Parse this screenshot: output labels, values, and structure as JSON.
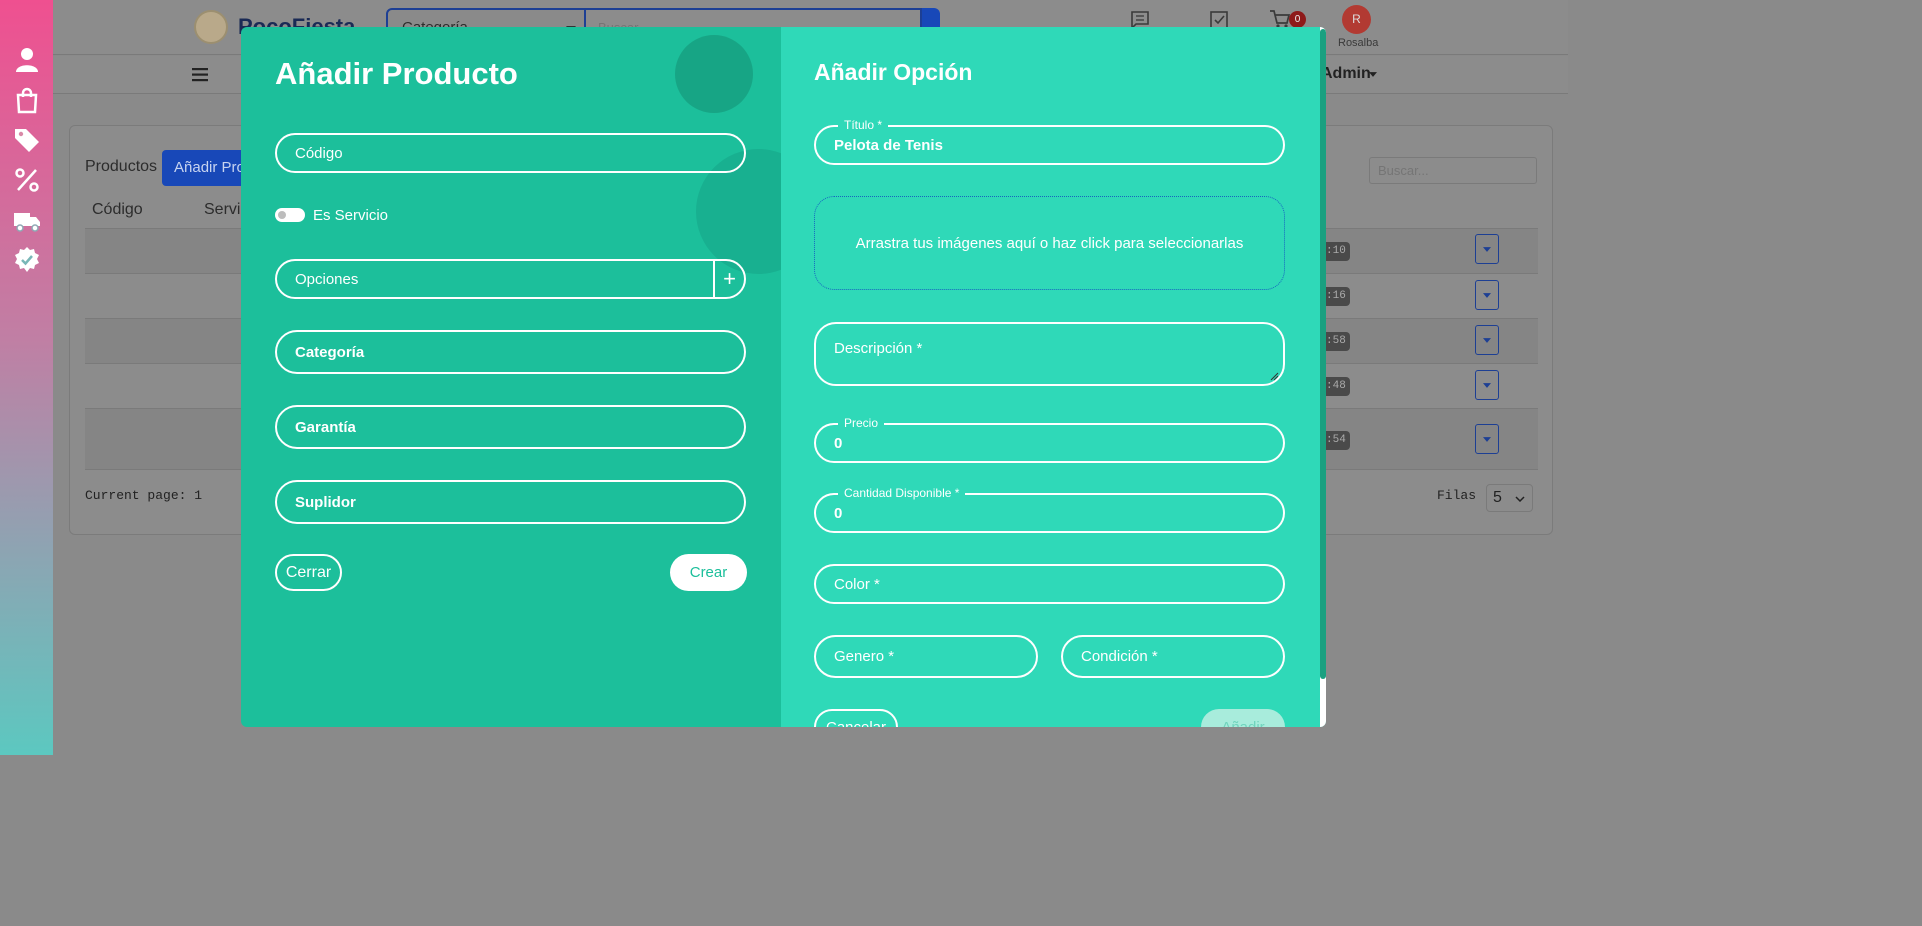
{
  "top": {
    "brand": "PocoFiesta",
    "category_select": "Categoría",
    "search_placeholder": "Buscar",
    "cart_count": "0",
    "avatar_initial": "R",
    "user_name": "Rosalba"
  },
  "nav": {
    "admin": "Admin"
  },
  "page": {
    "tab_products": "Productos",
    "tab_add": "Añadir Pro",
    "col_code": "Código",
    "col_service": "Servic",
    "search_placeholder": "Buscar...",
    "badges": [
      ":10",
      ":16",
      ":58",
      ":48",
      ":54"
    ],
    "current_page": "Current page: 1",
    "rows_label": "Filas",
    "rows_value": "5"
  },
  "left_panel": {
    "title": "Añadir Producto",
    "code_placeholder": "Código",
    "service_label": "Es Servicio",
    "options_placeholder": "Opciones",
    "add_option_symbol": "+",
    "category_placeholder": "Categoría",
    "warranty_placeholder": "Garantía",
    "supplier_placeholder": "Suplidor",
    "close_label": "Cerrar",
    "create_label": "Crear"
  },
  "right_panel": {
    "title": "Añadir Opción",
    "title_legend": "Título *",
    "title_value": "Pelota de Tenis",
    "dropzone_text": "Arrastra tus imágenes aquí o haz click para seleccionarlas",
    "description_placeholder": "Descripción *",
    "price_legend": "Precio",
    "price_value": "0",
    "quantity_legend": "Cantidad Disponible *",
    "quantity_value": "0",
    "color_placeholder": "Color *",
    "gender_placeholder": "Genero *",
    "condition_placeholder": "Condición *",
    "cancel_label": "Cancelar",
    "add_label": "Añadir"
  }
}
